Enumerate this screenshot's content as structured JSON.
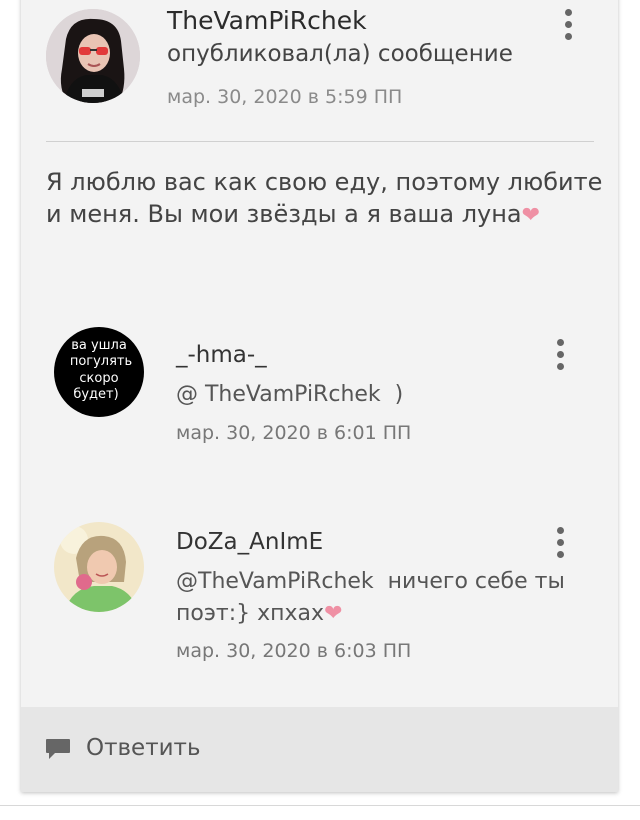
{
  "post": {
    "author": "TheVamPiRchek",
    "action": "опубликовал(ла) сообщение",
    "time": "мар. 30, 2020 в 5:59 ПП",
    "text": "Я люблю вас как свою еду, поэтому любите и меня. Вы мои звёзды а я ваша луна",
    "heart": "❤"
  },
  "comments": [
    {
      "author": "_-hma-_",
      "mention": "@ TheVamPiRchek",
      "text": ")",
      "time": "мар. 30, 2020 в 6:01 ПП",
      "avatar_text": [
        "ва ушла",
        "погулять",
        "скоро",
        "будет)"
      ]
    },
    {
      "author": "DoZa_AnImE",
      "mention": "@TheVamPiRchek",
      "text": "ничего себе ты поэт:} хпхах",
      "heart": "❤",
      "time": "мар. 30, 2020 в 6:03 ПП"
    }
  ],
  "reply": {
    "label": "Ответить"
  },
  "colors": {
    "heart": "#ef90a4",
    "card": "#f3f3f3",
    "reply_bar": "#e6e6e6"
  },
  "icons": {
    "more": "more-vertical-icon",
    "reply": "speech-bubble-icon"
  }
}
